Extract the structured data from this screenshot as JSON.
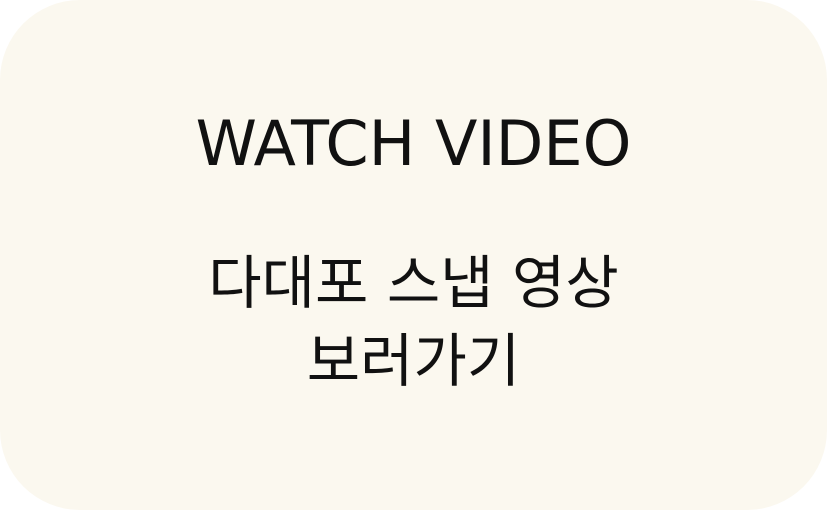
{
  "button": {
    "title": "WATCH VIDEO",
    "subtitle_line1": "다대포 스냅 영상",
    "subtitle_line2": "보러가기"
  },
  "colors": {
    "background": "#fbf8ef",
    "text": "#111111"
  }
}
